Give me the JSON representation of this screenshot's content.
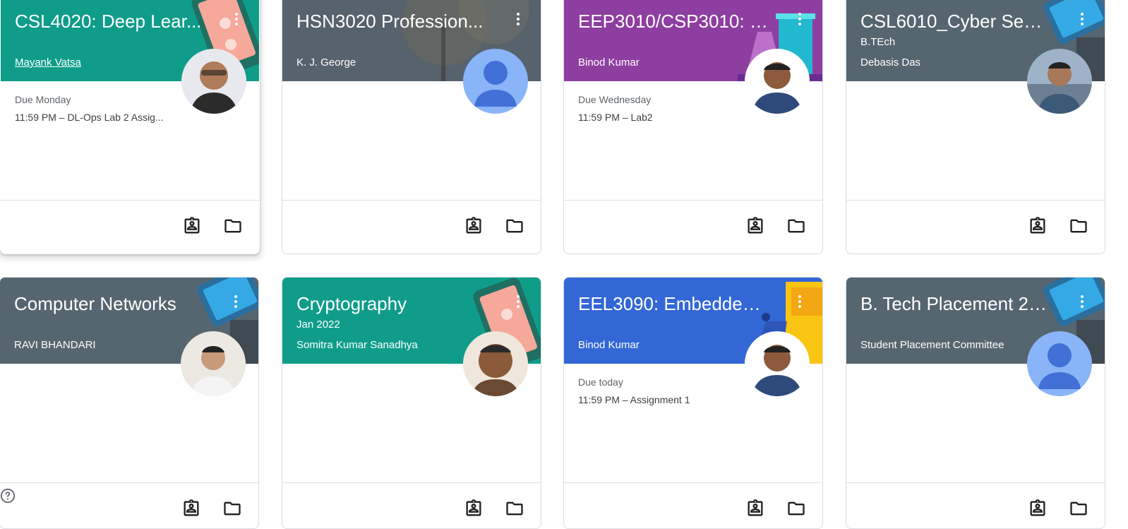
{
  "classes": [
    {
      "title": "CSL4020: Deep Lear...",
      "section": "",
      "teacher": "Mayank Vatsa",
      "due_label": "Due Monday",
      "due_item": "11:59 PM – DL-Ops Lab 2 Assig...",
      "banner_color": "#0f9d8a",
      "avatar": "photo"
    },
    {
      "title": "HSN3020 Profession...",
      "section": "",
      "teacher": "K. J. George",
      "due_label": "",
      "due_item": "",
      "banner_color": "#4a5661",
      "avatar": "default"
    },
    {
      "title": "EEP3010/CSP3010: Di...",
      "section": "",
      "teacher": "Binod Kumar",
      "due_label": "Due Wednesday",
      "due_item": "11:59 PM – Lab2",
      "banner_color": "#8e3ea0",
      "avatar": "photo"
    },
    {
      "title": "CSL6010_Cyber Secu...",
      "section": "B.TEch",
      "teacher": "Debasis Das",
      "due_label": "",
      "due_item": "",
      "banner_color": "#566670",
      "avatar": "photo"
    },
    {
      "title": "Computer Networks",
      "section": "",
      "teacher": "RAVI BHANDARI",
      "due_label": "",
      "due_item": "",
      "banner_color": "#566670",
      "avatar": "photo"
    },
    {
      "title": "Cryptography",
      "section": "Jan 2022",
      "teacher": "Somitra Kumar Sanadhya",
      "due_label": "",
      "due_item": "",
      "banner_color": "#0f9d8a",
      "avatar": "photo"
    },
    {
      "title": "EEL3090: Embedded ...",
      "section": "",
      "teacher": "Binod Kumar",
      "due_label": "Due today",
      "due_item": "11:59 PM – Assignment 1",
      "banner_color": "#3367d6",
      "avatar": "photo"
    },
    {
      "title": "B. Tech Placement 20...",
      "section": "",
      "teacher": "Student Placement Committee",
      "due_label": "",
      "due_item": "",
      "banner_color": "#566670",
      "avatar": "default"
    }
  ],
  "icons": {
    "more": "more-vert-icon",
    "work": "assignment-ind-icon",
    "folder": "folder-icon",
    "help": "help-icon"
  }
}
